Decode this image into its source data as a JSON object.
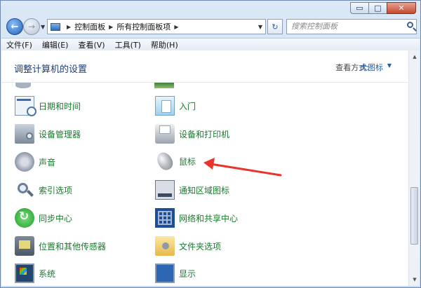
{
  "window": {
    "caption": {
      "minimize": "▭",
      "maximize": "□",
      "close": "✕"
    }
  },
  "address": {
    "segments": [
      "控制面板",
      "所有控制面板项"
    ],
    "refresh_glyph": "↻"
  },
  "search": {
    "placeholder": "搜索控制面板"
  },
  "menu": [
    "文件(F)",
    "编辑(E)",
    "查看(V)",
    "工具(T)",
    "帮助(H)"
  ],
  "main": {
    "title": "调整计算机的设置",
    "view_mode_label": "查看方式:",
    "view_mode_value": "大图标"
  },
  "items_left": [
    {
      "label": "日期和时间",
      "icon": "calendar-clock-icon"
    },
    {
      "label": "设备管理器",
      "icon": "device-manager-icon"
    },
    {
      "label": "声音",
      "icon": "speaker-icon"
    },
    {
      "label": "索引选项",
      "icon": "index-search-icon"
    },
    {
      "label": "同步中心",
      "icon": "sync-icon"
    },
    {
      "label": "位置和其他传感器",
      "icon": "sensor-icon"
    },
    {
      "label": "系统",
      "icon": "system-icon"
    }
  ],
  "items_right": [
    {
      "label": "入门",
      "icon": "getting-started-icon"
    },
    {
      "label": "设备和打印机",
      "icon": "printer-icon"
    },
    {
      "label": "鼠标",
      "icon": "mouse-icon"
    },
    {
      "label": "通知区域图标",
      "icon": "tray-icon"
    },
    {
      "label": "网络和共享中心",
      "icon": "network-icon"
    },
    {
      "label": "文件夹选项",
      "icon": "folder-options-icon"
    },
    {
      "label": "显示",
      "icon": "display-icon"
    }
  ],
  "annotation": {
    "color": "#e8342a"
  },
  "colors": {
    "link_green": "#1a7a2e",
    "title_blue": "#1e3f74",
    "accent": "#1f5fb7"
  }
}
